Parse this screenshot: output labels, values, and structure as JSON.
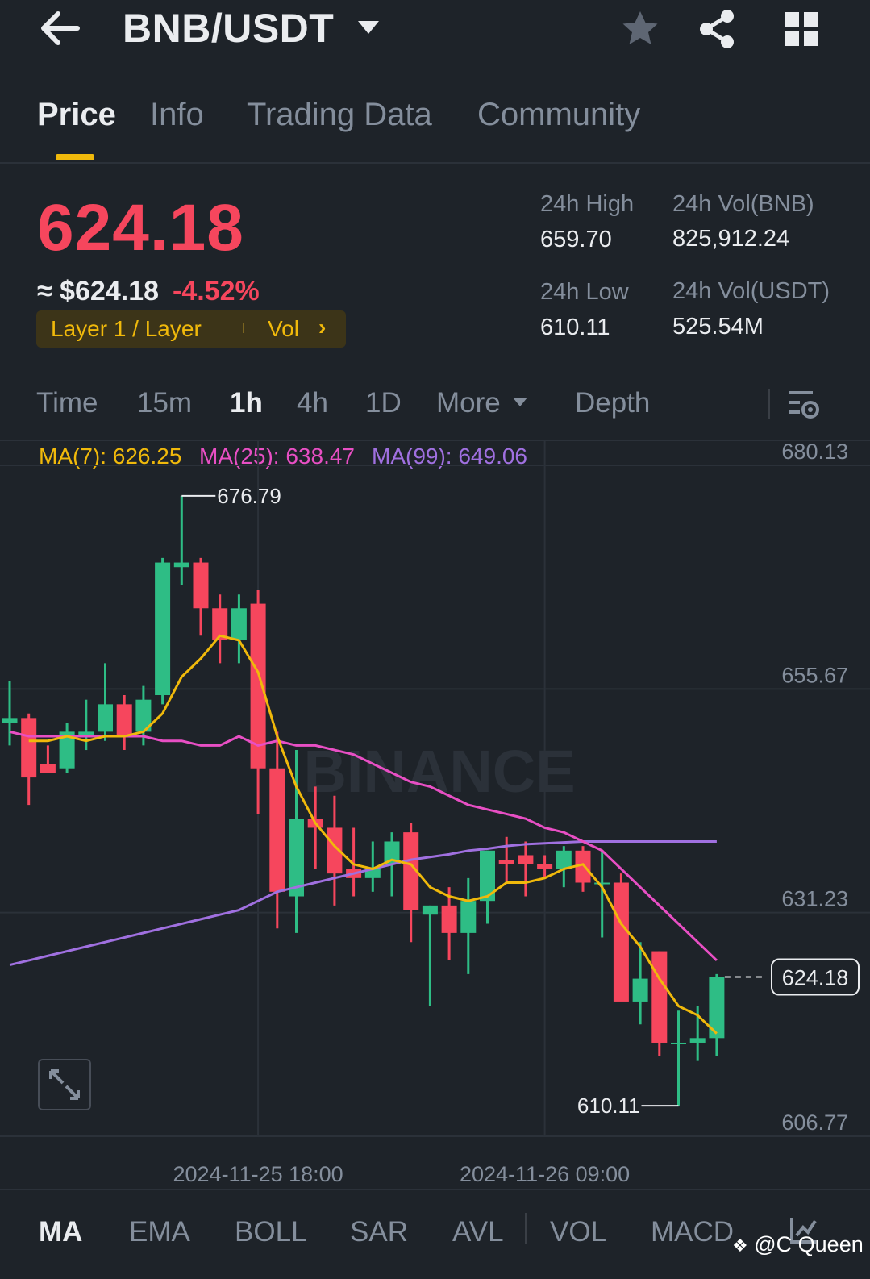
{
  "header": {
    "back_icon": "arrow-left-icon",
    "pair": "BNB/USDT",
    "star_icon": "star-icon",
    "share_icon": "share-icon",
    "grid_icon": "grid-icon"
  },
  "tabs": [
    {
      "label": "Price",
      "active": true
    },
    {
      "label": "Info",
      "active": false
    },
    {
      "label": "Trading Data",
      "active": false
    },
    {
      "label": "Community",
      "active": false
    }
  ],
  "ticker": {
    "last_price": "624.18",
    "fiat_price": "≈ $624.18",
    "change_pct": "-4.52%",
    "tag_label": "Layer 1 / Layer",
    "tag_vol": "Vol",
    "tag_arrow": "›",
    "high_label": "24h High",
    "high_value": "659.70",
    "low_label": "24h Low",
    "low_value": "610.11",
    "vol_base_label": "24h Vol(BNB)",
    "vol_base_value": "825,912.24",
    "vol_quote_label": "24h Vol(USDT)",
    "vol_quote_value": "525.54M",
    "up_color": "#2ebd85",
    "down_color": "#f6465d",
    "accent_color": "#f0b90b"
  },
  "intervals": {
    "items": [
      "Time",
      "15m",
      "1h",
      "4h",
      "1D"
    ],
    "active": "1h",
    "more": "More",
    "depth": "Depth",
    "settings_icon": "chart-settings-icon"
  },
  "ma_legend": {
    "ma7": "MA(7): 626.25",
    "ma25": "MA(25): 638.47",
    "ma99": "MA(99): 649.06",
    "ma7_color": "#f0b90b",
    "ma25_color": "#e84fc4",
    "ma99_color": "#a070e0"
  },
  "chart_data": {
    "type": "candlestick",
    "interval": "1h",
    "ylim": [
      606.77,
      680.13
    ],
    "y_ticks": [
      "680.13",
      "655.67",
      "631.23",
      "606.77"
    ],
    "x_ticks": [
      "2024-11-25 18:00",
      "2024-11-26 09:00"
    ],
    "high_label": "676.79",
    "low_label": "610.11",
    "last_label": "624.18",
    "watermark": "BINANCE",
    "candles": [
      [
        652.0,
        656.5,
        649.5,
        652.5
      ],
      [
        652.5,
        653.0,
        643.0,
        646.0
      ],
      [
        647.5,
        649.5,
        646.5,
        646.5
      ],
      [
        647.0,
        652.0,
        646.5,
        651.0
      ],
      [
        650.5,
        654.5,
        649.0,
        651.0
      ],
      [
        651.0,
        658.5,
        650.0,
        654.0
      ],
      [
        654.0,
        655.0,
        649.0,
        650.5
      ],
      [
        651.0,
        656.0,
        649.5,
        654.5
      ],
      [
        655.0,
        670.0,
        654.0,
        669.5
      ],
      [
        669.0,
        676.79,
        667.0,
        669.5
      ],
      [
        669.5,
        670.0,
        661.5,
        664.5
      ],
      [
        664.5,
        666.0,
        658.5,
        661.0
      ],
      [
        661.0,
        666.0,
        658.5,
        664.5
      ],
      [
        665.0,
        666.5,
        642.0,
        647.0
      ],
      [
        647.0,
        651.0,
        629.5,
        633.5
      ],
      [
        633.0,
        649.0,
        629.0,
        641.5
      ],
      [
        641.5,
        645.0,
        636.0,
        640.5
      ],
      [
        640.5,
        644.0,
        632.0,
        635.5
      ],
      [
        636.0,
        640.5,
        633.0,
        635.0
      ],
      [
        635.0,
        639.0,
        633.5,
        636.0
      ],
      [
        636.5,
        640.0,
        633.0,
        639.0
      ],
      [
        640.0,
        641.0,
        628.0,
        631.5
      ],
      [
        631.0,
        632.0,
        621.0,
        632.0
      ],
      [
        632.0,
        634.0,
        626.0,
        629.0
      ],
      [
        629.0,
        635.0,
        624.5,
        632.5
      ],
      [
        632.5,
        638.0,
        630.0,
        638.0
      ],
      [
        637.0,
        639.5,
        634.5,
        636.5
      ],
      [
        637.5,
        639.0,
        633.0,
        636.5
      ],
      [
        636.5,
        637.5,
        635.0,
        636.0
      ],
      [
        636.0,
        638.5,
        634.0,
        638.0
      ],
      [
        638.0,
        638.5,
        633.5,
        634.5
      ],
      [
        634.5,
        638.0,
        628.5,
        634.5
      ],
      [
        634.5,
        635.5,
        622.0,
        621.5
      ],
      [
        621.5,
        628.0,
        619.0,
        624.0
      ],
      [
        627.0,
        627.0,
        615.5,
        617.0
      ],
      [
        617.0,
        620.5,
        610.11,
        617.0
      ],
      [
        617.0,
        621.0,
        615.0,
        617.5
      ],
      [
        617.5,
        624.5,
        615.5,
        624.18
      ]
    ],
    "ma7": [
      null,
      650.0,
      650.0,
      650.5,
      650.0,
      650.5,
      650.5,
      651.0,
      653.0,
      657.0,
      659.0,
      661.5,
      661.0,
      657.5,
      650.5,
      645.0,
      641.0,
      638.5,
      636.5,
      636.0,
      637.0,
      636.5,
      634.0,
      633.0,
      632.5,
      633.0,
      634.5,
      634.5,
      635.0,
      636.0,
      636.5,
      634.0,
      630.0,
      627.5,
      624.0,
      621.0,
      620.0,
      618.0
    ],
    "ma25": [
      651.0,
      650.5,
      650.5,
      650.5,
      650.5,
      650.5,
      650.5,
      650.5,
      650.0,
      650.0,
      649.5,
      649.5,
      650.5,
      649.5,
      650.0,
      649.5,
      649.5,
      649.0,
      648.5,
      647.5,
      646.5,
      645.5,
      645.0,
      644.0,
      643.0,
      642.5,
      642.0,
      641.5,
      640.5,
      640.0,
      639.0,
      638.0,
      636.0,
      634.0,
      632.0,
      630.0,
      628.0,
      626.0
    ],
    "ma99": [
      625.5,
      626.0,
      626.5,
      627.0,
      627.5,
      628.0,
      628.5,
      629.0,
      629.5,
      630.0,
      630.5,
      631.0,
      631.5,
      632.5,
      633.5,
      634.0,
      634.5,
      635.0,
      635.5,
      636.0,
      636.5,
      637.0,
      637.3,
      637.6,
      638.0,
      638.2,
      638.5,
      638.7,
      638.8,
      638.9,
      639.0,
      639.0,
      639.0,
      639.0,
      639.0,
      639.0,
      639.0,
      639.0
    ]
  },
  "indicators": {
    "items": [
      "MA",
      "EMA",
      "BOLL",
      "SAR",
      "AVL",
      "VOL",
      "MACD"
    ],
    "active": "MA",
    "config_icon": "indicator-config-icon"
  },
  "watermark_text": "@C Queen"
}
